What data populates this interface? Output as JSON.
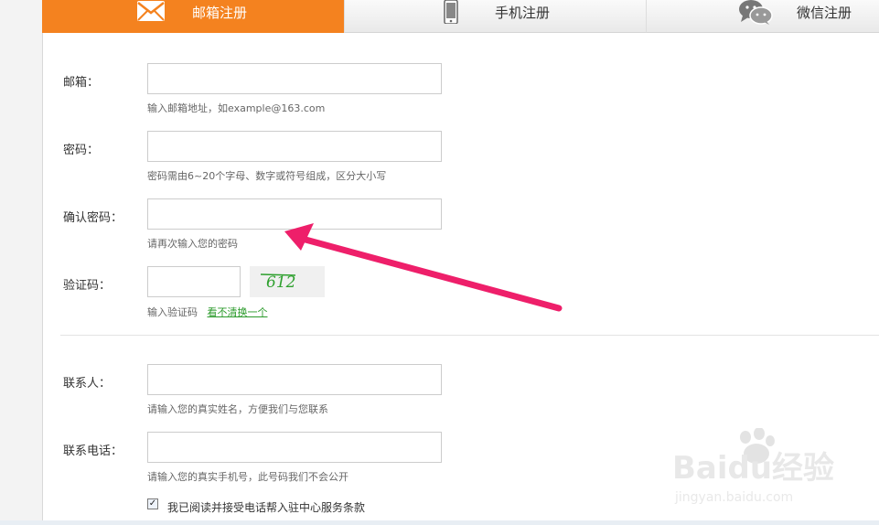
{
  "tabs": [
    {
      "label": "邮箱注册",
      "icon": "envelope-icon"
    },
    {
      "label": "手机注册",
      "icon": "phone-icon"
    },
    {
      "label": "微信注册",
      "icon": "wechat-icon"
    }
  ],
  "form": {
    "email": {
      "label": "邮箱：",
      "hint": "输入邮箱地址，如example@163.com",
      "value": ""
    },
    "password": {
      "label": "密码：",
      "hint": "密码需由6~20个字母、数字或符号组成，区分大小写",
      "value": ""
    },
    "confirm": {
      "label": "确认密码：",
      "hint": "请再次输入您的密码",
      "value": ""
    },
    "captcha": {
      "label": "验证码：",
      "hint": "输入验证码",
      "refresh": "看不清换一个",
      "image_text": "612",
      "value": ""
    },
    "contact": {
      "label": "联系人：",
      "hint": "请输入您的真实姓名，方便我们与您联系",
      "value": ""
    },
    "phone": {
      "label": "联系电话：",
      "hint": "请输入您的真实手机号，此号码我们不会公开",
      "value": ""
    },
    "agree": {
      "label": "我已阅读并接受电话帮入驻中心服务条款",
      "checked": true
    }
  },
  "watermark": {
    "text": "Baidu经验",
    "sub": "jingyan.baidu.com"
  },
  "colors": {
    "accent": "#f4821f",
    "arrow": "#ee1f6a",
    "link": "#2a9a2a"
  }
}
